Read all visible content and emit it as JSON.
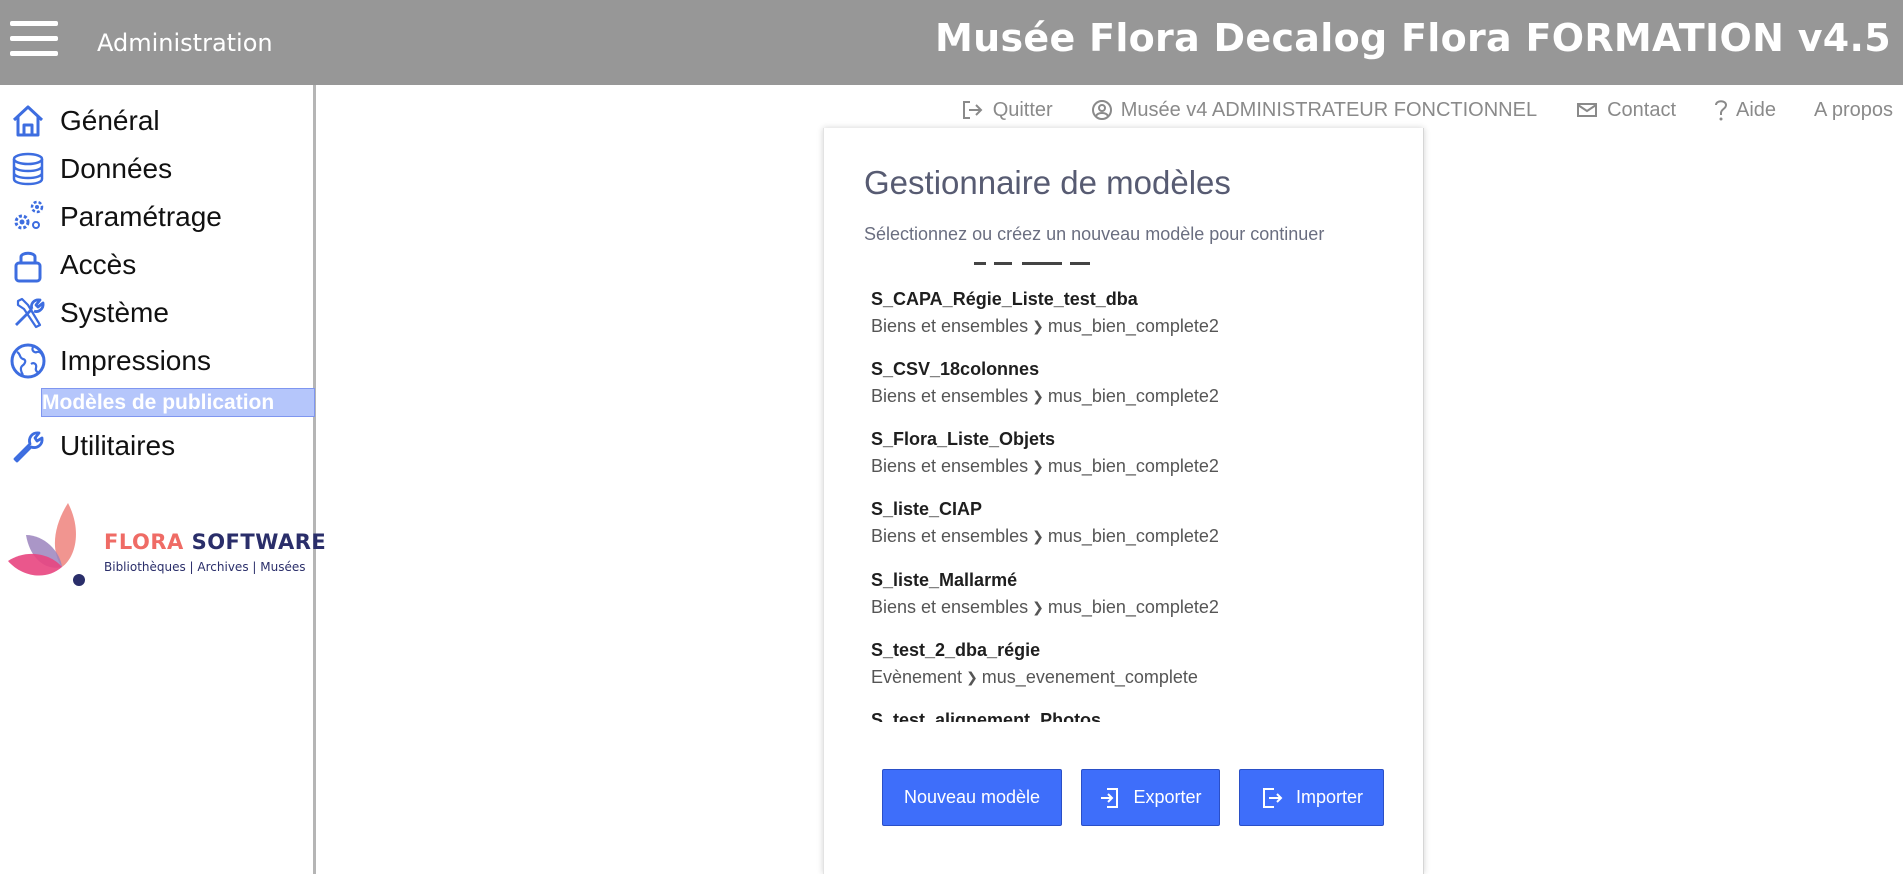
{
  "header": {
    "section": "Administration",
    "title": "Musée Flora Decalog Flora FORMATION v4.5"
  },
  "sidebar": {
    "items": [
      {
        "label": "Général",
        "icon": "home-icon"
      },
      {
        "label": "Données",
        "icon": "database-icon"
      },
      {
        "label": "Paramétrage",
        "icon": "gears-icon"
      },
      {
        "label": "Accès",
        "icon": "lock-icon"
      },
      {
        "label": "Système",
        "icon": "tools-icon"
      },
      {
        "label": "Impressions",
        "icon": "globe-icon"
      },
      {
        "label": "Utilitaires",
        "icon": "wrench-icon"
      }
    ],
    "active_sub": "Modèles de publication",
    "logo": {
      "brand_part1": "FLORA",
      "brand_part2": "SOFTWARE",
      "tagline": "Bibliothèques | Archives | Musées"
    }
  },
  "toolbar": {
    "quit": "Quitter",
    "user": "Musée v4 ADMINISTRATEUR FONCTIONNEL",
    "contact": "Contact",
    "help": "Aide",
    "about": "A propos"
  },
  "panel": {
    "title": "Gestionnaire de modèles",
    "subtitle": "Sélectionnez ou créez un nouveau modèle pour continuer",
    "models": [
      {
        "name": "S_CAPA_Régie_Liste_test_dba",
        "domain": "Biens et ensembles",
        "view": "mus_bien_complete2"
      },
      {
        "name": "S_CSV_18colonnes",
        "domain": "Biens et ensembles",
        "view": "mus_bien_complete2"
      },
      {
        "name": "S_Flora_Liste_Objets",
        "domain": "Biens et ensembles",
        "view": "mus_bien_complete2"
      },
      {
        "name": "S_liste_CIAP",
        "domain": "Biens et ensembles",
        "view": "mus_bien_complete2"
      },
      {
        "name": "S_liste_Mallarmé",
        "domain": "Biens et ensembles",
        "view": "mus_bien_complete2"
      },
      {
        "name": "S_test_2_dba_régie",
        "domain": "Evènement",
        "view": "mus_evenement_complete"
      },
      {
        "name": "S_test_alignement_Photos",
        "domain": "",
        "view": ""
      }
    ],
    "buttons": {
      "new": "Nouveau modèle",
      "export": "Exporter",
      "import": "Importer"
    }
  },
  "colors": {
    "topbar": "#979797",
    "accent": "#3e6efa",
    "icon_blue": "#3d6de0",
    "active_sub_bg": "#b5c6fb"
  }
}
